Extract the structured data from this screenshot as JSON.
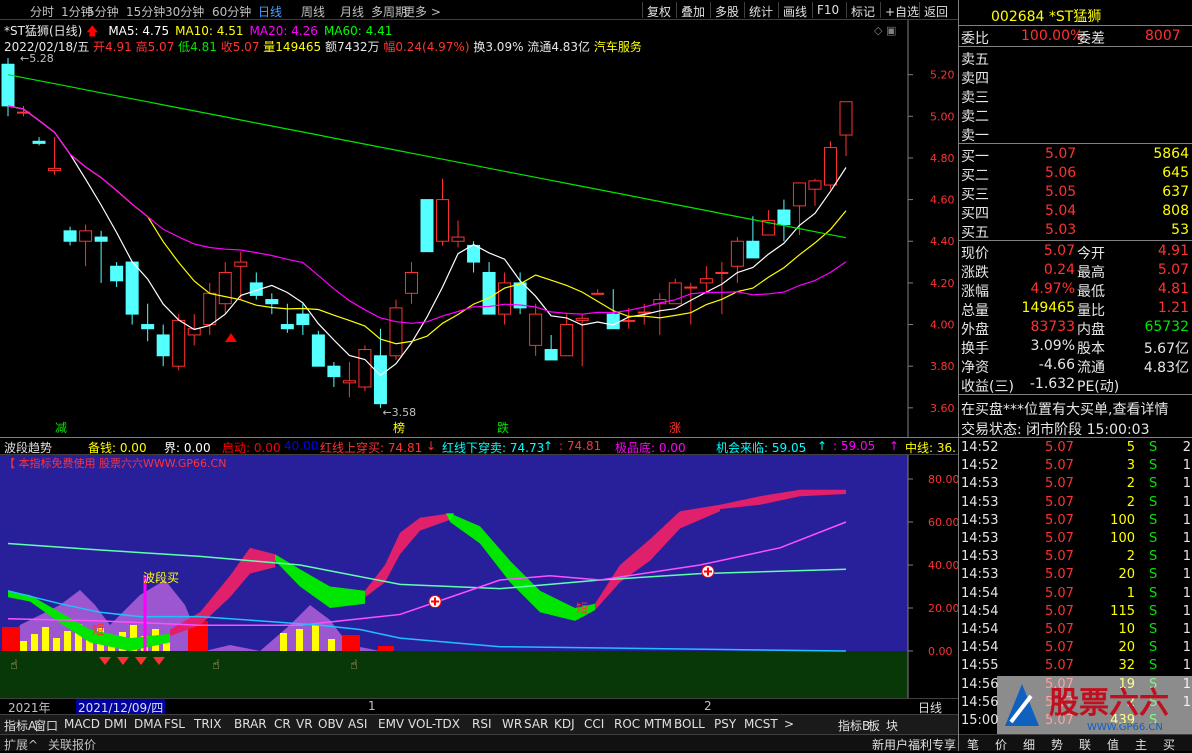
{
  "toolbar": {
    "periods": [
      "分时",
      "1分钟",
      "5分钟",
      "15分钟",
      "30分钟",
      "60分钟",
      "日线",
      "周线",
      "月线",
      "多周期",
      "更多 >"
    ],
    "active": "日线",
    "right": [
      "复权",
      "叠加",
      "多股",
      "统计",
      "画线",
      "F10",
      "标记",
      "+自选",
      "返回"
    ]
  },
  "chart": {
    "title": "*ST猛狮(日线)",
    "ma": [
      {
        "label": "MA5: 4.75",
        "color": "#ffffff"
      },
      {
        "label": "MA10: 4.51",
        "color": "#ffff00"
      },
      {
        "label": "MA20: 4.26",
        "color": "#ff00ff"
      },
      {
        "label": "MA60: 4.41",
        "color": "#00ff00"
      }
    ],
    "date": "2022/02/18/五",
    "open": "开4.91",
    "high": "高5.07",
    "low": "低4.81",
    "close": "收5.07",
    "vol": "量149465",
    "amt": "额7432万",
    "chg": "幅0.24(4.97%)",
    "turn": "换3.09%",
    "float": "流通4.83亿",
    "sector": "汽车服务",
    "price_ticks": [
      "5.20",
      "5.00",
      "4.80",
      "4.60",
      "4.40",
      "4.20",
      "4.00",
      "3.80",
      "3.60"
    ],
    "high_label": "5.28",
    "low_label": "3.58",
    "markers": [
      "减",
      "榜",
      "跌",
      "涨"
    ],
    "candles": [
      [
        5.25,
        5.28,
        5.0,
        5.05
      ],
      [
        5.02,
        5.05,
        5.0,
        5.02
      ],
      [
        4.88,
        4.9,
        4.86,
        4.87
      ],
      [
        4.74,
        4.9,
        4.72,
        4.75
      ],
      [
        4.45,
        4.47,
        4.38,
        4.4
      ],
      [
        4.4,
        4.48,
        4.28,
        4.45
      ],
      [
        4.42,
        4.45,
        4.2,
        4.4
      ],
      [
        4.28,
        4.3,
        4.18,
        4.21
      ],
      [
        4.3,
        4.3,
        4.0,
        4.05
      ],
      [
        4.0,
        4.1,
        3.92,
        3.98
      ],
      [
        3.95,
        4.0,
        3.8,
        3.85
      ],
      [
        3.8,
        4.05,
        3.78,
        4.02
      ],
      [
        3.95,
        4.05,
        3.9,
        3.98
      ],
      [
        4.0,
        4.2,
        3.95,
        4.15
      ],
      [
        4.1,
        4.3,
        4.05,
        4.25
      ],
      [
        4.28,
        4.35,
        4.12,
        4.3
      ],
      [
        4.2,
        4.25,
        4.12,
        4.14
      ],
      [
        4.12,
        4.15,
        4.05,
        4.1
      ],
      [
        4.0,
        4.1,
        3.96,
        3.98
      ],
      [
        4.05,
        4.1,
        3.95,
        4.0
      ],
      [
        3.95,
        3.97,
        3.8,
        3.8
      ],
      [
        3.8,
        3.82,
        3.7,
        3.75
      ],
      [
        3.72,
        3.82,
        3.65,
        3.73
      ],
      [
        3.7,
        3.9,
        3.68,
        3.88
      ],
      [
        3.85,
        3.98,
        3.6,
        3.62
      ],
      [
        3.85,
        4.12,
        3.83,
        4.08
      ],
      [
        4.15,
        4.3,
        4.1,
        4.25
      ],
      [
        4.6,
        4.6,
        4.35,
        4.35
      ],
      [
        4.4,
        4.7,
        4.38,
        4.6
      ],
      [
        4.4,
        4.5,
        4.37,
        4.42
      ],
      [
        4.38,
        4.4,
        4.25,
        4.3
      ],
      [
        4.25,
        4.3,
        4.05,
        4.05
      ],
      [
        4.05,
        4.25,
        4.0,
        4.2
      ],
      [
        4.2,
        4.25,
        4.05,
        4.08
      ],
      [
        3.9,
        4.1,
        3.85,
        4.05
      ],
      [
        3.88,
        3.95,
        3.85,
        3.83
      ],
      [
        3.85,
        4.05,
        3.85,
        4.0
      ],
      [
        4.02,
        4.05,
        3.8,
        4.03
      ],
      [
        4.15,
        4.17,
        4.15,
        4.15
      ],
      [
        4.05,
        4.17,
        3.98,
        3.98
      ],
      [
        4.02,
        4.08,
        3.98,
        4.02
      ],
      [
        4.06,
        4.1,
        4.0,
        4.06
      ],
      [
        4.1,
        4.15,
        3.95,
        4.12
      ],
      [
        4.1,
        4.22,
        4.1,
        4.2
      ],
      [
        4.18,
        4.2,
        4.0,
        4.18
      ],
      [
        4.2,
        4.28,
        4.15,
        4.22
      ],
      [
        4.25,
        4.3,
        4.05,
        4.25
      ],
      [
        4.28,
        4.42,
        4.2,
        4.4
      ],
      [
        4.4,
        4.52,
        4.38,
        4.32
      ],
      [
        4.43,
        4.55,
        4.45,
        4.5
      ],
      [
        4.55,
        4.6,
        4.4,
        4.48
      ],
      [
        4.57,
        4.68,
        4.43,
        4.68
      ],
      [
        4.65,
        4.7,
        4.57,
        4.69
      ],
      [
        4.67,
        4.88,
        4.65,
        4.85
      ],
      [
        4.91,
        5.07,
        4.81,
        5.07
      ]
    ]
  },
  "ind": {
    "name": "波段趋势",
    "items": [
      {
        "t": "备钱: 0.00",
        "c": "#ffff00"
      },
      {
        "t": "界: 0.00",
        "c": "#ffffff"
      },
      {
        "t": "启动: 0.00",
        "c": "#ff0000"
      },
      {
        "t": "40.00",
        "c": "#0000ff"
      },
      {
        "t": "红线上穿买: 74.81",
        "c": "#ff3232"
      },
      {
        "t": "↓",
        "c": "#ff3232"
      },
      {
        "t": "红线下穿卖: 74.73",
        "c": "#00ffff"
      },
      {
        "t": "↑",
        "c": "#00ffff"
      },
      {
        "t": ": 74.81",
        "c": "#ff3232"
      },
      {
        "t": "极品底: 0.00",
        "c": "#ff00ff"
      },
      {
        "t": "机会来临: 59.05",
        "c": "#00ffff"
      },
      {
        "t": "↑",
        "c": "#00ffff"
      },
      {
        "t": ": 59.05",
        "c": "#ff00ff"
      },
      {
        "t": "↑",
        "c": "#ff00ff"
      },
      {
        "t": "中线: 36.",
        "c": "#ffff00"
      }
    ],
    "banner": "【 本指标免费使用 股票六六WWW.GP66.CN",
    "ticks": [
      "80.00",
      "60.00",
      "40.00",
      "20.00",
      "0.00"
    ],
    "buy_label": "波段买",
    "short_label": "短"
  },
  "timebar": {
    "year": "2021年",
    "date": "2021/12/09/四",
    "m1": "1",
    "m2": "2",
    "period": "日线"
  },
  "tabs": [
    "指标A",
    "窗口",
    "MACD",
    "DMI",
    "DMA",
    "FSL",
    "TRIX",
    "BRAR",
    "CR",
    "VR",
    "OBV",
    "ASI",
    "EMV",
    "VOL-TDX",
    "RSI",
    "WR",
    "SAR",
    "KDJ",
    "CCI",
    "ROC",
    "MTM",
    "BOLL",
    "PSY",
    "MCST",
    ">",
    "指标B",
    "板",
    "块"
  ],
  "status": {
    "left": [
      "扩展^",
      "关联报价"
    ],
    "right": "新用户福利专享",
    "icons": [
      "笔",
      "价",
      "细",
      "势",
      "联",
      "值",
      "主",
      "买"
    ]
  },
  "quote": {
    "code": "002684 *ST猛狮",
    "wb": "委比",
    "wb_v": "100.00%",
    "wc": "委差",
    "wc_v": "8007",
    "asks": [
      "卖五",
      "卖四",
      "卖三",
      "卖二",
      "卖一"
    ],
    "bids": [
      {
        "l": "买一",
        "p": "5.07",
        "v": "5864"
      },
      {
        "l": "买二",
        "p": "5.06",
        "v": "645"
      },
      {
        "l": "买三",
        "p": "5.05",
        "v": "637"
      },
      {
        "l": "买四",
        "p": "5.04",
        "v": "808"
      },
      {
        "l": "买五",
        "p": "5.03",
        "v": "53"
      }
    ],
    "stats": [
      [
        {
          "t": "现价",
          "c": "white"
        },
        {
          "t": "5.07",
          "c": "red"
        },
        {
          "t": "今开",
          "c": "white"
        },
        {
          "t": "4.91",
          "c": "red"
        }
      ],
      [
        {
          "t": "涨跌",
          "c": "white"
        },
        {
          "t": "0.24",
          "c": "red"
        },
        {
          "t": "最高",
          "c": "white"
        },
        {
          "t": "5.07",
          "c": "red"
        }
      ],
      [
        {
          "t": "涨幅",
          "c": "white"
        },
        {
          "t": "4.97%",
          "c": "red"
        },
        {
          "t": "最低",
          "c": "white"
        },
        {
          "t": "4.81",
          "c": "red"
        }
      ],
      [
        {
          "t": "总量",
          "c": "white"
        },
        {
          "t": "149465",
          "c": "yellow"
        },
        {
          "t": "量比",
          "c": "white"
        },
        {
          "t": "1.21",
          "c": "red"
        }
      ],
      [
        {
          "t": "外盘",
          "c": "white"
        },
        {
          "t": "83733",
          "c": "red"
        },
        {
          "t": "内盘",
          "c": "white"
        },
        {
          "t": "65732",
          "c": "green"
        }
      ],
      [
        {
          "t": "换手",
          "c": "white"
        },
        {
          "t": "3.09%",
          "c": "white"
        },
        {
          "t": "股本",
          "c": "white"
        },
        {
          "t": "5.67亿",
          "c": "white"
        }
      ],
      [
        {
          "t": "净资",
          "c": "white"
        },
        {
          "t": "-4.66",
          "c": "white"
        },
        {
          "t": "流通",
          "c": "white"
        },
        {
          "t": "4.83亿",
          "c": "white"
        }
      ],
      [
        {
          "t": "收益(三)",
          "c": "white"
        },
        {
          "t": "-1.632",
          "c": "white"
        },
        {
          "t": "PE(动)",
          "c": "white"
        },
        {
          "t": "",
          "c": "white"
        }
      ]
    ],
    "notice": "在买盘***位置有大买单,查看详情",
    "state": "交易状态: 闭市阶段 15:00:03",
    "trades": [
      [
        "14:52",
        "5.07",
        "5",
        "S",
        "2"
      ],
      [
        "14:52",
        "5.07",
        "3",
        "S",
        "1"
      ],
      [
        "14:53",
        "5.07",
        "2",
        "S",
        "1"
      ],
      [
        "14:53",
        "5.07",
        "2",
        "S",
        "1"
      ],
      [
        "14:53",
        "5.07",
        "100",
        "S",
        "1"
      ],
      [
        "14:53",
        "5.07",
        "100",
        "S",
        "1"
      ],
      [
        "14:53",
        "5.07",
        "2",
        "S",
        "1"
      ],
      [
        "14:53",
        "5.07",
        "20",
        "S",
        "1"
      ],
      [
        "14:54",
        "5.07",
        "1",
        "S",
        "1"
      ],
      [
        "14:54",
        "5.07",
        "115",
        "S",
        "1"
      ],
      [
        "14:54",
        "5.07",
        "10",
        "S",
        "1"
      ],
      [
        "14:54",
        "5.07",
        "20",
        "S",
        "1"
      ],
      [
        "14:55",
        "5.07",
        "32",
        "S",
        "1"
      ],
      [
        "14:56",
        "5.07",
        "19",
        "S",
        "1"
      ],
      [
        "14:56",
        "5.07",
        "2",
        "S",
        "1"
      ],
      [
        "15:00",
        "5.07",
        "439",
        "S",
        ""
      ]
    ],
    "watermark": "股票六六",
    "watermark_url": "WWW.GP66.CN"
  }
}
